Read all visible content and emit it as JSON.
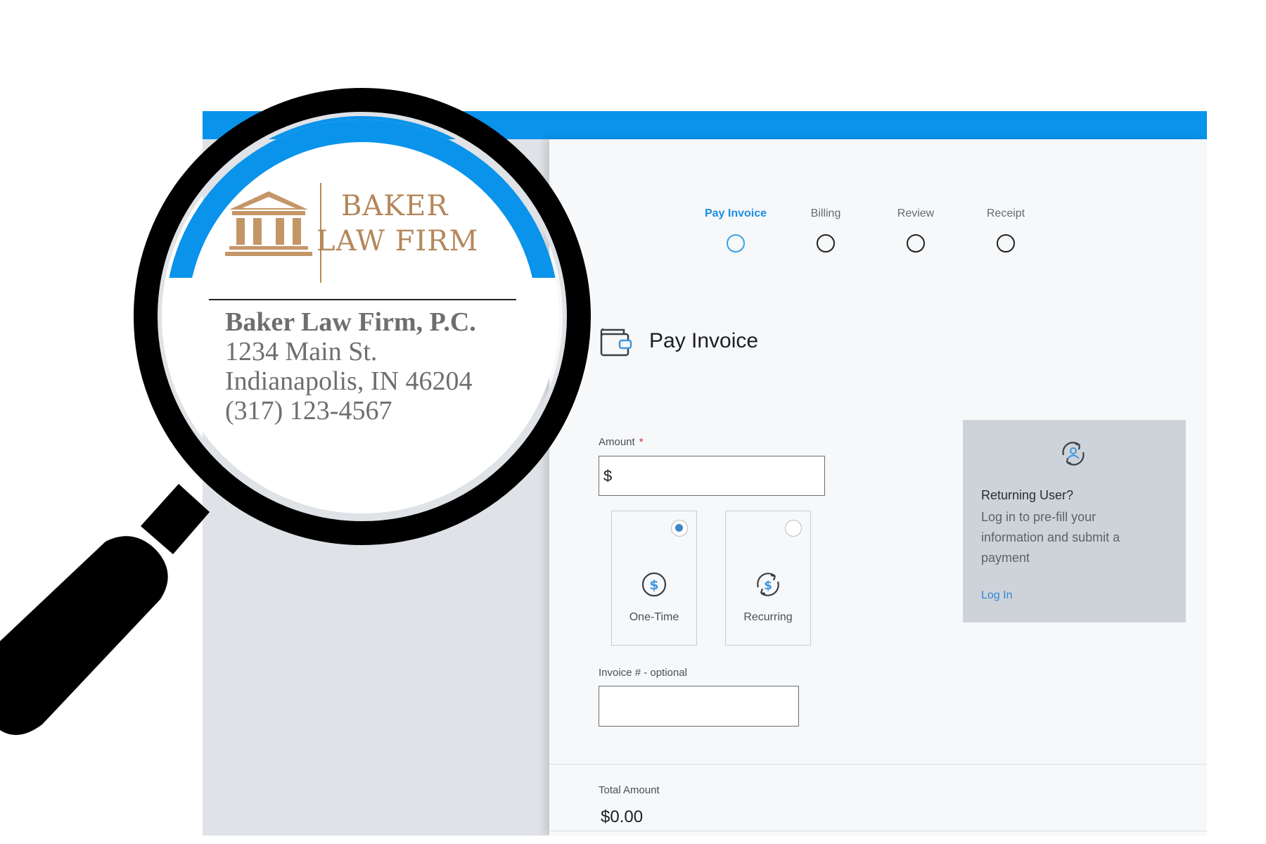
{
  "steps": [
    {
      "label": "Pay Invoice",
      "active": true
    },
    {
      "label": "Billing",
      "active": false
    },
    {
      "label": "Review",
      "active": false
    },
    {
      "label": "Receipt",
      "active": false
    }
  ],
  "page_title": "Pay Invoice",
  "amount": {
    "label": "Amount",
    "required_mark": "*",
    "prefix": "$"
  },
  "payment_options": [
    {
      "label": "One-Time",
      "selected": true,
      "icon": "dollar-circle-icon"
    },
    {
      "label": "Recurring",
      "selected": false,
      "icon": "recurring-dollar-icon"
    }
  ],
  "invoice": {
    "label": "Invoice # - optional"
  },
  "total": {
    "label": "Total Amount",
    "value": "$0.00"
  },
  "returning_user": {
    "title": "Returning User?",
    "description": "Log in to pre-fill your information and submit a payment",
    "link": "Log In"
  },
  "logo": {
    "line1": "BAKER",
    "line2": "LAW FIRM"
  },
  "firm_info": {
    "name": "Baker Law Firm, P.C.",
    "street": "1234 Main St.",
    "city": "Indianapolis, IN 46204",
    "phone": "(317) 123-4567"
  },
  "colors": {
    "accent": "#0a93ea",
    "logo_gold": "#b4875a",
    "link": "#2f86d6",
    "required": "#d62828"
  }
}
